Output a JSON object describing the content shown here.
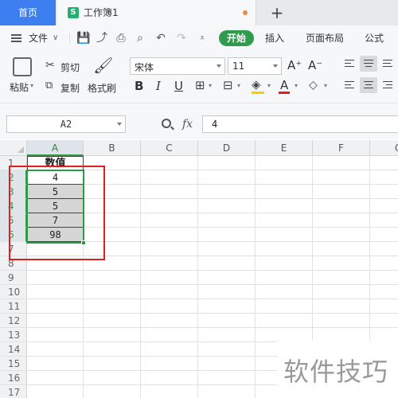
{
  "tabs": {
    "home_label": "首页",
    "doc_icon_letter": "S",
    "doc_title": "工作簿1",
    "add_label": "+"
  },
  "menu": {
    "file_label": "文件",
    "start_label": "开始",
    "insert_label": "插入",
    "page_layout_label": "页面布局",
    "formula_label": "公式"
  },
  "ribbon": {
    "paste_label": "粘贴",
    "cut_label": "剪切",
    "copy_label": "复制",
    "format_painter_label": "格式刷",
    "font_name": "宋体",
    "font_size": "11",
    "bold": "B",
    "italic": "I",
    "underline": "U",
    "font_color_letter": "A",
    "grow_font": "A⁺",
    "shrink_font": "A⁻"
  },
  "formula_bar": {
    "name_box": "A2",
    "fx_label": "fx",
    "formula_value": "4"
  },
  "grid": {
    "columns": [
      "A",
      "B",
      "C",
      "D",
      "E",
      "F",
      "G"
    ],
    "rows": [
      "1",
      "2",
      "3",
      "4",
      "5",
      "6",
      "7",
      "8",
      "9",
      "10",
      "11",
      "12",
      "13",
      "14",
      "15",
      "16",
      "17"
    ],
    "a1": "数值",
    "values": [
      "4",
      "5",
      "5",
      "7",
      "98"
    ]
  },
  "watermark": "软件技巧",
  "colors": {
    "tab_home": "#3d7ef0",
    "start_button": "#2e9b4e",
    "selection": "#2f9b47",
    "annotation": "#e02020"
  }
}
